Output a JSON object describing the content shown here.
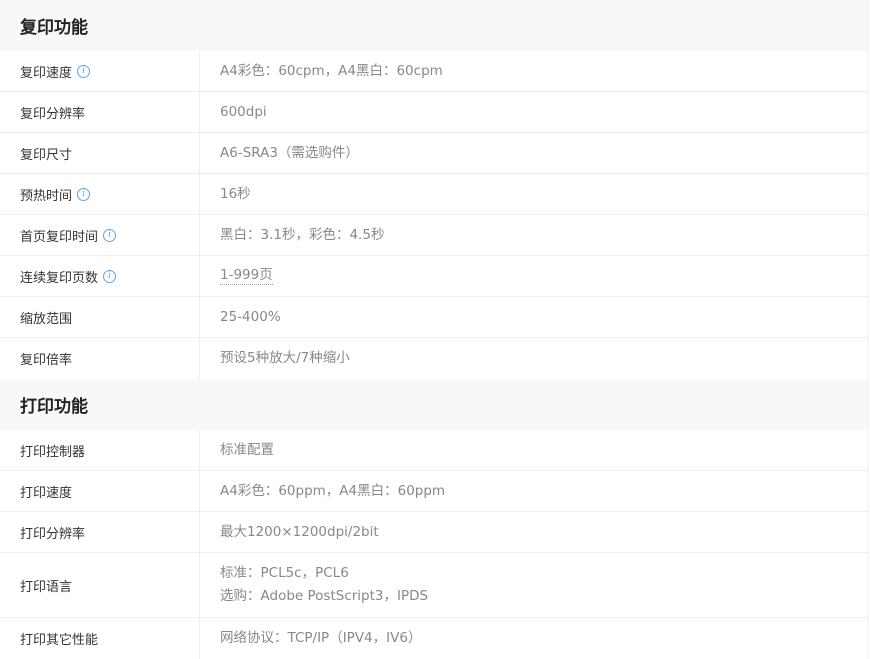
{
  "copy": {
    "title": "复印功能",
    "rows": [
      {
        "label": "复印速度",
        "value": "A4彩色：60cpm，A4黑白：60cpm"
      },
      {
        "label": "复印分辨率",
        "value": "600dpi"
      },
      {
        "label": "复印尺寸",
        "value": "A6-SRA3（需选购件）"
      },
      {
        "label": "预热时间",
        "value": "16秒"
      },
      {
        "label": "首页复印时间",
        "value": "黑白：3.1秒，彩色：4.5秒"
      },
      {
        "label": "连续复印页数",
        "value": "1-999页"
      },
      {
        "label": "缩放范围",
        "value": "25-400%"
      },
      {
        "label": "复印倍率",
        "value": "预设5种放大/7种缩小"
      }
    ]
  },
  "print": {
    "title": "打印功能",
    "rows": [
      {
        "label": "打印控制器",
        "value": "标准配置"
      },
      {
        "label": "打印速度",
        "value": "A4彩色：60ppm，A4黑白：60ppm"
      },
      {
        "label": "打印分辨率",
        "value": "最大1200×1200dpi/2bit"
      },
      {
        "label": "打印语言",
        "value_line1": "标准：PCL5c，PCL6",
        "value_line2": "选购：Adobe PostScript3，IPDS"
      },
      {
        "label": "打印其它性能",
        "value": "网络协议：TCP/IP（IPV4，IV6）"
      }
    ]
  },
  "icons": {
    "info": "i"
  },
  "colors": {
    "accent": "#5aa8e6",
    "section_bg": "#f8f8f8",
    "label_text": "#333333",
    "value_text": "#888888"
  }
}
